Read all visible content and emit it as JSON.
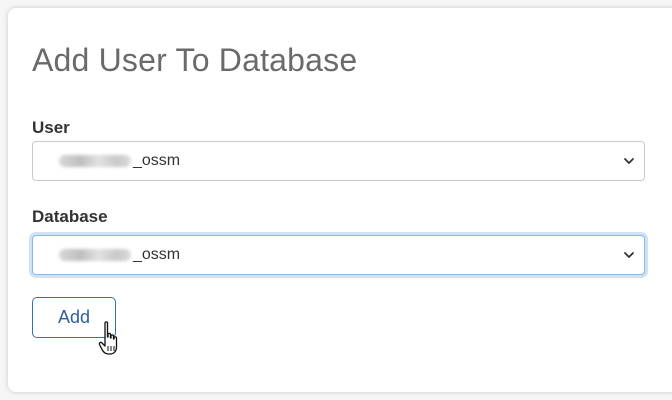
{
  "form": {
    "title": "Add User To Database",
    "user_label": "User",
    "user_value": "_ossm",
    "database_label": "Database",
    "database_value": "_ossm",
    "add_label": "Add"
  },
  "icons": {
    "select_arrow": "chevron-down-icon",
    "cursor": "hand-pointer-cursor"
  },
  "colors": {
    "button_border": "#3a6fb0",
    "button_text": "#2f5f9a",
    "focus_ring": "#8cb8e6"
  }
}
